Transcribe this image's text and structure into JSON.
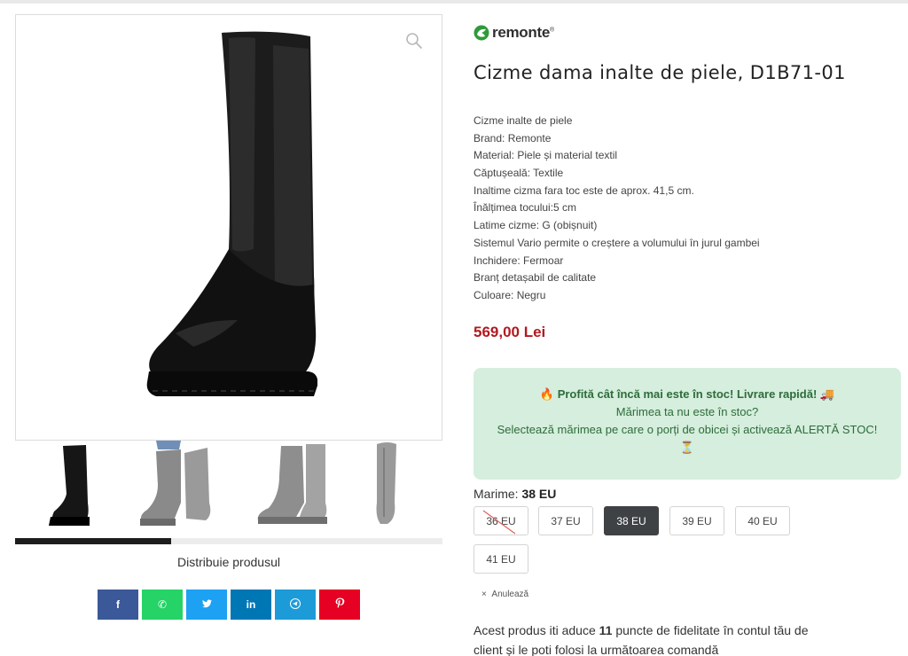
{
  "product": {
    "brand": "remonte",
    "brand_mark": "®",
    "title": "Cizme dama inalte de piele, D1B71-01",
    "specs": [
      "Cizme inalte de piele",
      "Brand: Remonte",
      "Material: Piele și material textil",
      "Căptușeală: Textile",
      "Inaltime cizma fara toc este de aprox. 41,5 cm.",
      "Înălțimea tocului:5 cm",
      "Latime cizme: G (obișnuit)",
      "Sistemul Vario permite o creștere a volumului în jurul gambei",
      "Inchidere: Fermoar",
      "Branț detașabil de calitate",
      "Culoare: Negru"
    ],
    "price": "569,00 Lei"
  },
  "stock_box": {
    "fire_icon": "🔥",
    "headline": "Profită cât încă mai este în stoc! Livrare rapidă!",
    "truck_icon": "🚚",
    "line2": "Mărimea ta nu este în stoc?",
    "line3": "Selectează mărimea pe care o porți de obicei și activează ALERTĂ STOC!",
    "hourglass_icon": "⏳"
  },
  "sizes": {
    "label": "Marime:",
    "selected": "38 EU",
    "options": [
      {
        "label": "36 EU",
        "state": "unavailable"
      },
      {
        "label": "37 EU",
        "state": "available"
      },
      {
        "label": "38 EU",
        "state": "selected"
      },
      {
        "label": "39 EU",
        "state": "available"
      },
      {
        "label": "40 EU",
        "state": "available"
      },
      {
        "label": "41 EU",
        "state": "available"
      }
    ],
    "reset_label": "Anulează",
    "reset_icon": "×"
  },
  "loyalty": {
    "prefix": "Acest produs iti aduce",
    "points": "11",
    "suffix": "puncte de fidelitate în contul tău de client și le poti folosi la următoarea comandă"
  },
  "gallery": {
    "zoom_icon": "search-icon",
    "progress_fraction": 0.365,
    "share_label": "Distribuie produsul",
    "share_buttons": [
      {
        "network": "facebook",
        "glyph": "f",
        "color": "#3b5998"
      },
      {
        "network": "whatsapp",
        "glyph": "✆",
        "color": "#25d366"
      },
      {
        "network": "twitter",
        "glyph": "🐦",
        "color": "#1da1f2"
      },
      {
        "network": "linkedin",
        "glyph": "in",
        "color": "#0077b5"
      },
      {
        "network": "telegram",
        "glyph": "➤",
        "color": "#1d9bd8"
      },
      {
        "network": "pinterest",
        "glyph": "P",
        "color": "#e60023"
      }
    ]
  },
  "colors": {
    "price": "#b3191f",
    "stock_box_bg": "#d5eedd",
    "stock_box_text": "#2e6c3a",
    "selected_size_bg": "#3f4245",
    "brand_green": "#2f9a3a"
  }
}
